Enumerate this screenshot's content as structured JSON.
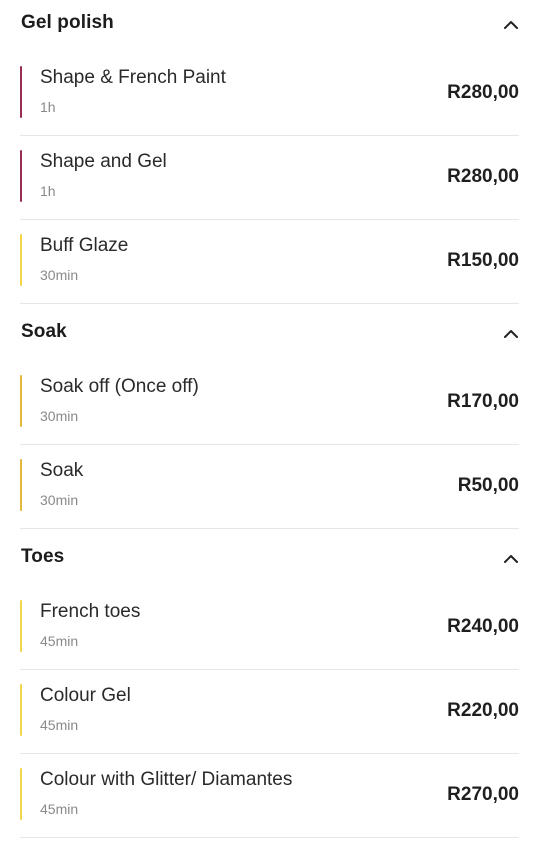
{
  "colors": {
    "accent_maroon": "#9b2f50",
    "accent_yellow": "#f0d64a",
    "accent_gold": "#e2b93b"
  },
  "sections": [
    {
      "title": "Gel polish",
      "expanded": true,
      "icon": "chevron-up-icon",
      "items": [
        {
          "name": "Shape & French Paint",
          "duration": "1h",
          "price": "R280,00",
          "accent": "#9b2f50"
        },
        {
          "name": "Shape and Gel",
          "duration": "1h",
          "price": "R280,00",
          "accent": "#9b2f50"
        },
        {
          "name": "Buff Glaze",
          "duration": "30min",
          "price": "R150,00",
          "accent": "#f0d64a"
        }
      ]
    },
    {
      "title": "Soak",
      "expanded": true,
      "icon": "chevron-up-icon",
      "items": [
        {
          "name": "Soak off (Once off)",
          "duration": "30min",
          "price": "R170,00",
          "accent": "#e2b93b"
        },
        {
          "name": "Soak",
          "duration": "30min",
          "price": "R50,00",
          "accent": "#e2b93b"
        }
      ]
    },
    {
      "title": "Toes",
      "expanded": true,
      "icon": "chevron-up-icon",
      "items": [
        {
          "name": "French toes",
          "duration": "45min",
          "price": "R240,00",
          "accent": "#f0d64a"
        },
        {
          "name": "Colour Gel",
          "duration": "45min",
          "price": "R220,00",
          "accent": "#f0d64a"
        },
        {
          "name": "Colour with Glitter/ Diamantes",
          "duration": "45min",
          "price": "R270,00",
          "accent": "#f0d64a"
        }
      ]
    }
  ]
}
